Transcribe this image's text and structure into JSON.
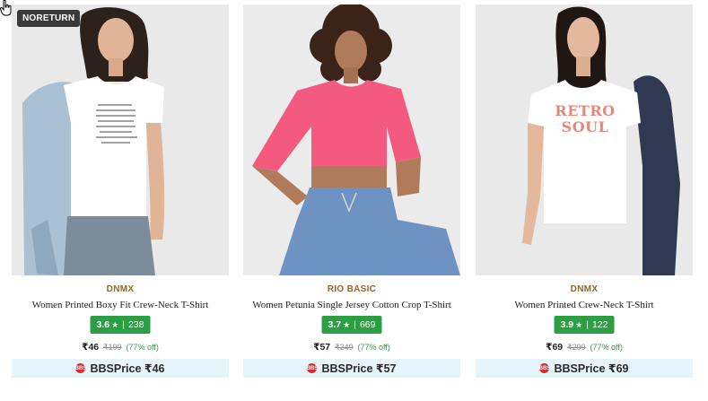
{
  "products": [
    {
      "badge": "NORETURN",
      "brand": "DNMX",
      "title": "Women Printed Boxy Fit Crew-Neck T-Shirt",
      "rating": "3.6",
      "reviews": "238",
      "price": "₹46",
      "mrp": "₹199",
      "discount": "(77% off)",
      "bbs_label": "BBSPrice ₹46",
      "shirt_color": "#ffffff"
    },
    {
      "brand": "RIO BASIC",
      "title": "Women Petunia Single Jersey Cotton Crop T-Shirt",
      "rating": "3.7",
      "reviews": "669",
      "price": "₹57",
      "mrp": "₹249",
      "discount": "(77% off)",
      "bbs_label": "BBSPrice ₹57",
      "shirt_color": "#f45a7f"
    },
    {
      "brand": "DNMX",
      "title": "Women Printed Crew-Neck T-Shirt",
      "rating": "3.9",
      "reviews": "122",
      "price": "₹69",
      "mrp": "₹299",
      "discount": "(77% off)",
      "bbs_label": "BBSPrice ₹69",
      "shirt_color": "#ffffff",
      "print_text": "RETRO SOUL"
    }
  ],
  "rating_star": "★",
  "rating_sep": "|",
  "bbs_logo": "BBS",
  "colors": {
    "rating_bg": "#2e9e45",
    "brand": "#8a6a2b",
    "bbs_bg": "#e6f4fb"
  }
}
